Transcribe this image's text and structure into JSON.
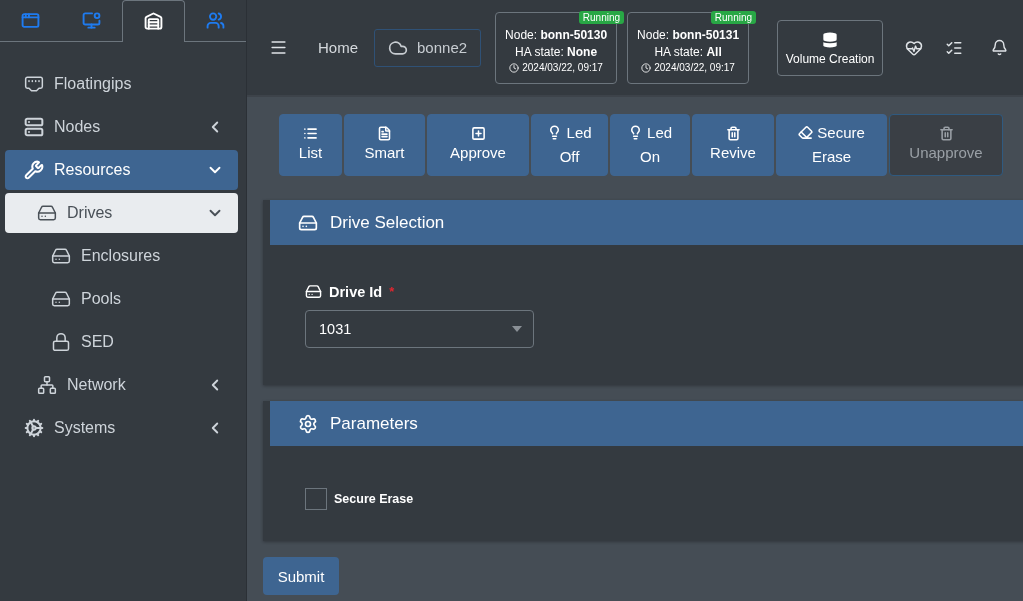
{
  "sidebar": {
    "tabs": [
      {
        "selected": false
      },
      {
        "selected": false
      },
      {
        "selected": true
      },
      {
        "selected": false
      }
    ],
    "items": [
      {
        "label": "Floatingips",
        "selected": false
      },
      {
        "label": "Nodes",
        "selected": false,
        "expanded": false
      },
      {
        "label": "Resources",
        "selected": true,
        "expanded": true,
        "children": [
          {
            "label": "Drives",
            "selected": true,
            "expanded": true,
            "children": [
              {
                "label": "Enclosures",
                "selected": false
              },
              {
                "label": "Pools",
                "selected": false
              },
              {
                "label": "SED",
                "selected": false
              }
            ]
          },
          {
            "label": "Network",
            "selected": false,
            "expanded": false
          }
        ]
      },
      {
        "label": "Systems",
        "selected": false,
        "expanded": false
      }
    ]
  },
  "header": {
    "home": "Home",
    "cluster": "bonne2",
    "nodes": [
      {
        "status": "Running",
        "node_label": "Node:",
        "node": "bonn-50130",
        "ha_label": "HA state:",
        "ha": "None",
        "time": "2024/03/22, 09:17"
      },
      {
        "status": "Running",
        "node_label": "Node:",
        "node": "bonn-50131",
        "ha_label": "HA state:",
        "ha": "All",
        "time": "2024/03/22, 09:17"
      }
    ],
    "volume_button": "Volume Creation"
  },
  "toolbar": [
    {
      "label": "List",
      "kind": "stacked",
      "disabled": false
    },
    {
      "label": "Smart",
      "kind": "stacked",
      "disabled": false
    },
    {
      "label": "Approve",
      "kind": "stacked",
      "disabled": false
    },
    {
      "label": "Led Off",
      "kind": "inline",
      "disabled": false
    },
    {
      "label": "Led On",
      "kind": "inline",
      "disabled": false
    },
    {
      "label": "Revive",
      "kind": "stacked",
      "disabled": false
    },
    {
      "label": "Secure Erase",
      "kind": "inline",
      "disabled": false
    },
    {
      "label": "Unapprove",
      "kind": "stacked",
      "disabled": true
    }
  ],
  "drive_selection": {
    "title": "Drive Selection",
    "field_label": "Drive Id",
    "required_mark": "*",
    "value": "1031"
  },
  "parameters": {
    "title": "Parameters",
    "options": [
      {
        "label": "Secure Erase",
        "checked": false
      }
    ]
  },
  "submit": "Submit"
}
